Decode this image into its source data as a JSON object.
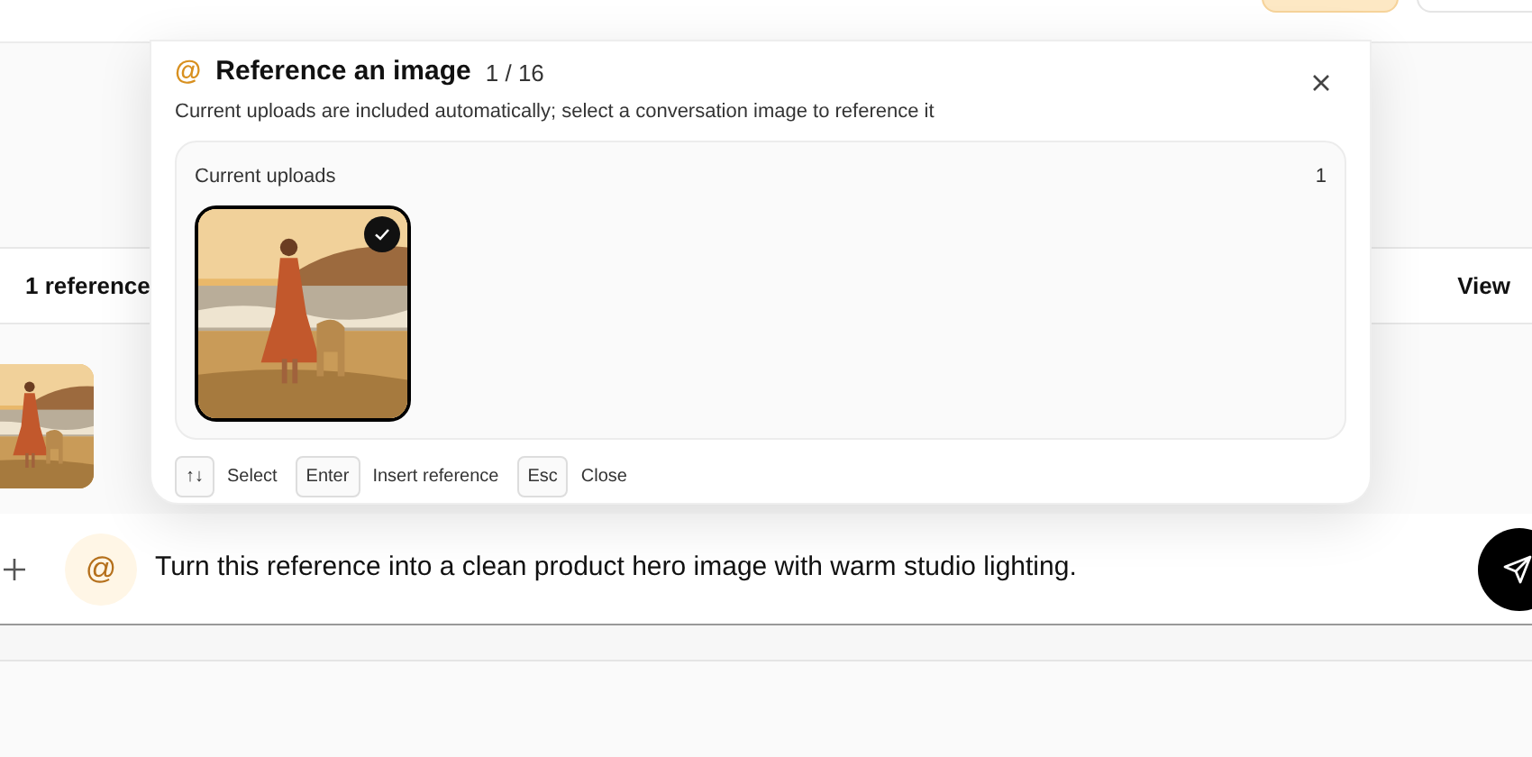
{
  "references": {
    "label": "1 reference",
    "action": "View"
  },
  "composer": {
    "mention": "@",
    "value": "Turn this reference into a clean product hero image with warm studio lighting."
  },
  "popup": {
    "mention": "@",
    "title": "Reference an image",
    "counter": "1 / 16",
    "subtitle": "Current uploads are included automatically; select a conversation image to reference it",
    "section": {
      "title": "Current uploads",
      "count": "1",
      "images": [
        {
          "kind": "picture",
          "selected": true
        }
      ]
    },
    "shortcuts": [
      {
        "key": "↑↓",
        "label": "Select"
      },
      {
        "key": "Enter",
        "label": "Insert reference"
      },
      {
        "key": "Esc",
        "label": "Close"
      }
    ]
  }
}
